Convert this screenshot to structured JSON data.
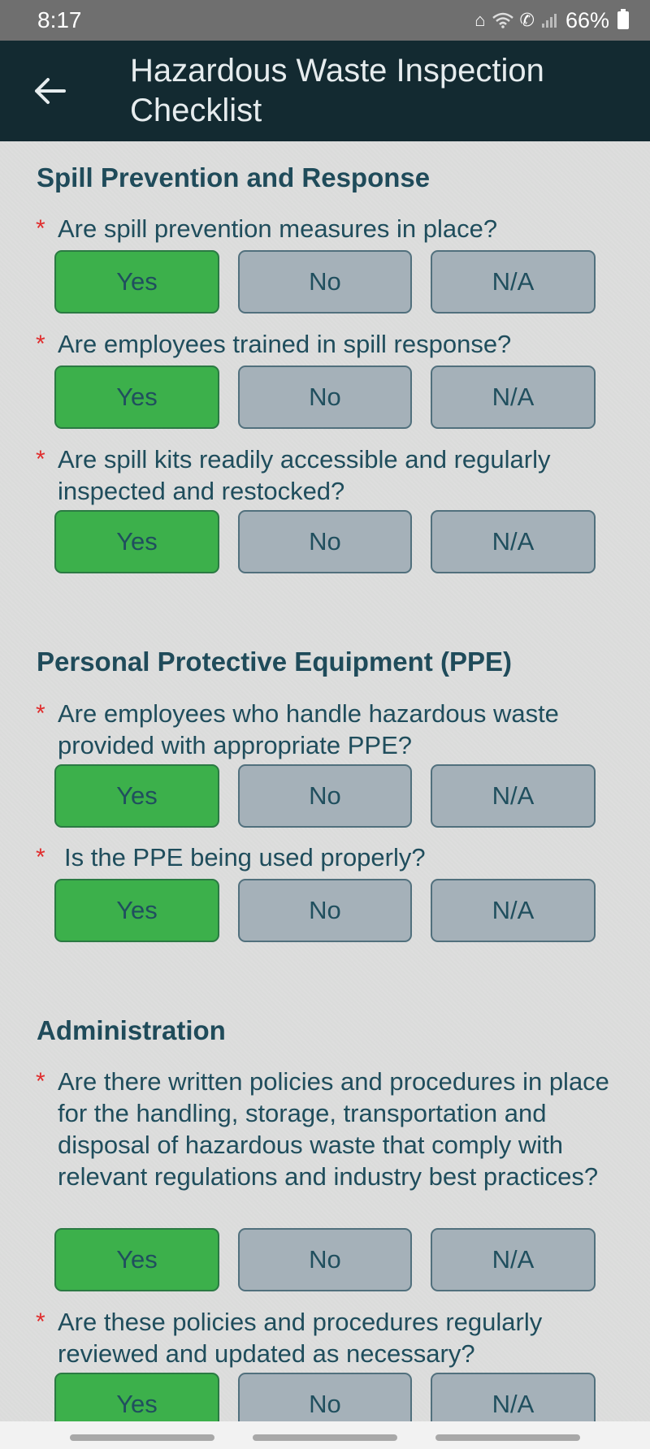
{
  "status_bar": {
    "time": "8:17",
    "battery": "66%",
    "icons": [
      "house-icon",
      "wifi-icon",
      "wifi-calling-icon",
      "signal-icon",
      "battery-icon"
    ]
  },
  "app_bar": {
    "title_line1": "Hazardous Waste Inspection",
    "title_line2": "Checklist",
    "back_icon": "arrow-left-icon"
  },
  "choice_labels": {
    "yes": "Yes",
    "no": "No",
    "na": "N/A"
  },
  "required_mark": "*",
  "sections": [
    {
      "title": "Spill Prevention and Response",
      "questions": [
        {
          "text": "Are spill prevention measures in place?",
          "selected": "Yes"
        },
        {
          "text": "Are employees trained in spill response?",
          "selected": "Yes"
        },
        {
          "text": "Are spill kits readily accessible and regularly inspected and restocked?",
          "selected": "Yes"
        }
      ]
    },
    {
      "title": "Personal Protective Equipment (PPE)",
      "questions": [
        {
          "text": "Are employees who handle hazardous waste provided with appropriate PPE?",
          "selected": "Yes"
        },
        {
          "text": "Is the PPE being used properly?",
          "selected": "Yes"
        }
      ]
    },
    {
      "title": "Administration",
      "questions": [
        {
          "text": "Are there written policies and procedures in place for the handling, storage, transportation and disposal of hazardous waste that comply with relevant regulations and industry best practices?",
          "selected": "Yes"
        },
        {
          "text": "Are these policies and procedures regularly reviewed and updated as necessary?",
          "selected": "Yes"
        }
      ]
    }
  ],
  "colors": {
    "selected": "#3cb04b",
    "unselected": "#a5b1b9",
    "app_bar": "#132a31",
    "required": "#e02d2d",
    "text": "#1f4d5c"
  }
}
